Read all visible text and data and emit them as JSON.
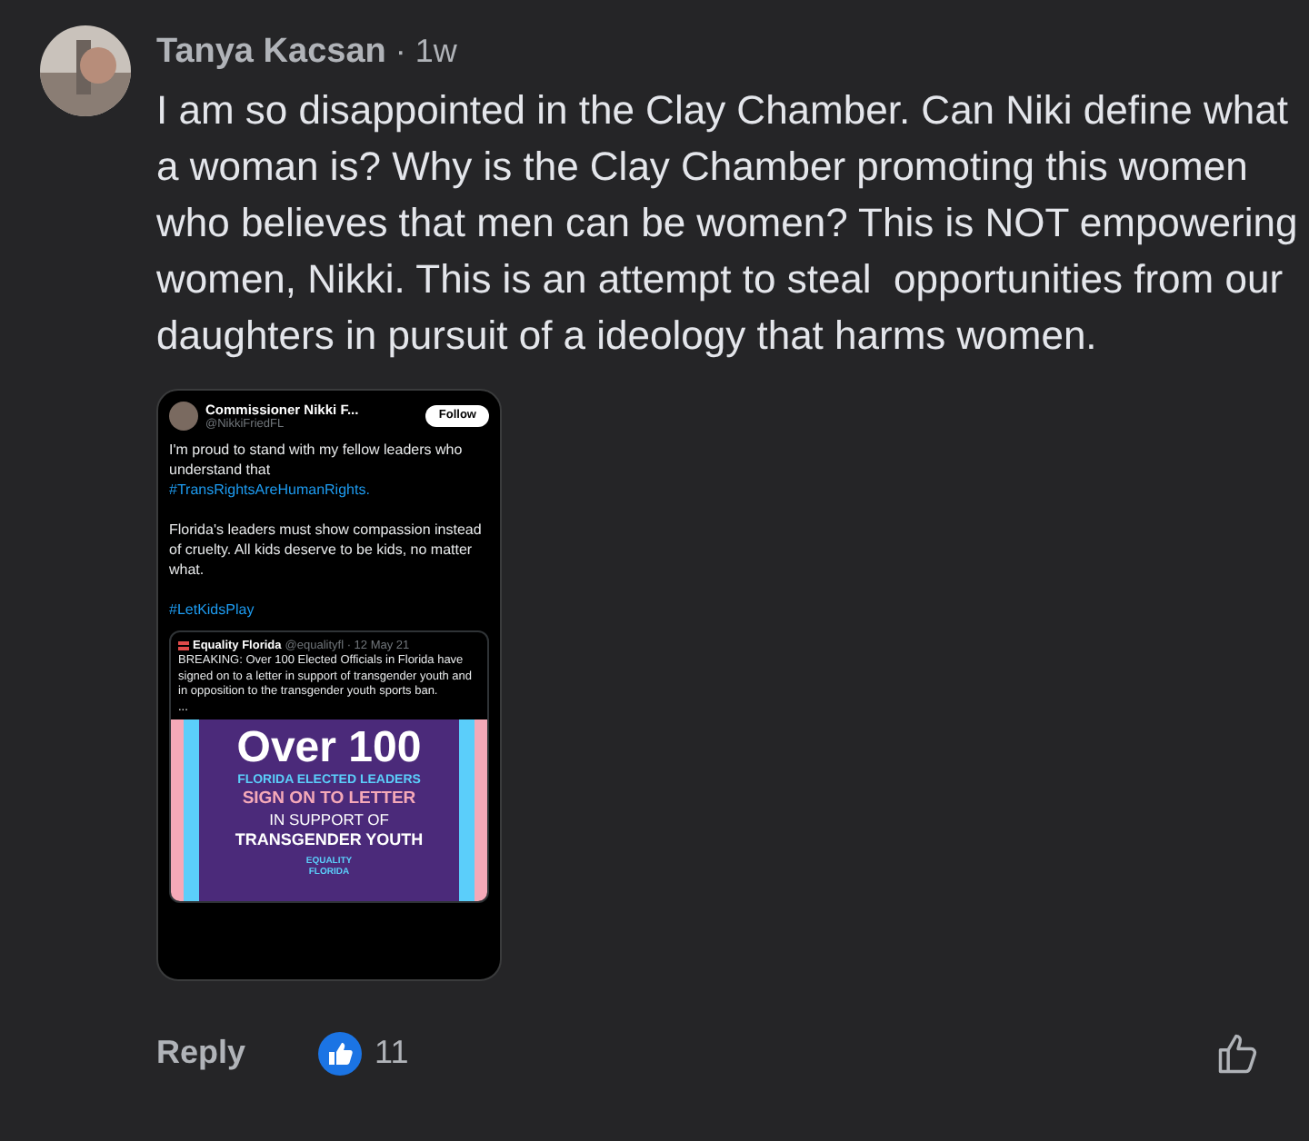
{
  "comment": {
    "author": "Tanya Kacsan",
    "time": "· 1w",
    "text": "I am so disappointed in the Clay Chamber. Can Niki define what a woman is? Why is the Clay Chamber promoting this women who believes that men can be women? This is NOT empowering women, Nikki. This is an attempt to steal  opportunities from our daughters in pursuit of a ideology that harms women."
  },
  "attachment": {
    "author": "Commissioner Nikki F...",
    "handle": "@NikkiFriedFL",
    "follow": "Follow",
    "paragraphs": [
      {
        "kind": "text",
        "text": "I'm proud to stand with my fellow leaders who understand that"
      },
      {
        "kind": "hashtag",
        "text": "#TransRightsAreHumanRights."
      },
      {
        "kind": "gap"
      },
      {
        "kind": "text",
        "text": "Florida's leaders must show compassion instead of cruelty. All kids deserve to be kids, no matter what."
      },
      {
        "kind": "gap"
      },
      {
        "kind": "hashtag",
        "text": "#LetKidsPlay"
      }
    ],
    "quote": {
      "author": "Equality Florida",
      "handle": "@equalityfl · 12 May 21",
      "text": "BREAKING: Over 100 Elected Officials in Florida have signed on to a letter in support of transgender youth and in opposition to the transgender youth sports ban.",
      "more": "...",
      "banner": {
        "headline": "Over 100",
        "line_1": "FLORIDA ELECTED LEADERS",
        "line_2": "SIGN ON TO LETTER",
        "line_3": "IN SUPPORT OF",
        "line_4": "TRANSGENDER YOUTH",
        "logo": "EQUALITY FLORIDA"
      }
    }
  },
  "actions": {
    "reply": "Reply",
    "likes": "11"
  }
}
